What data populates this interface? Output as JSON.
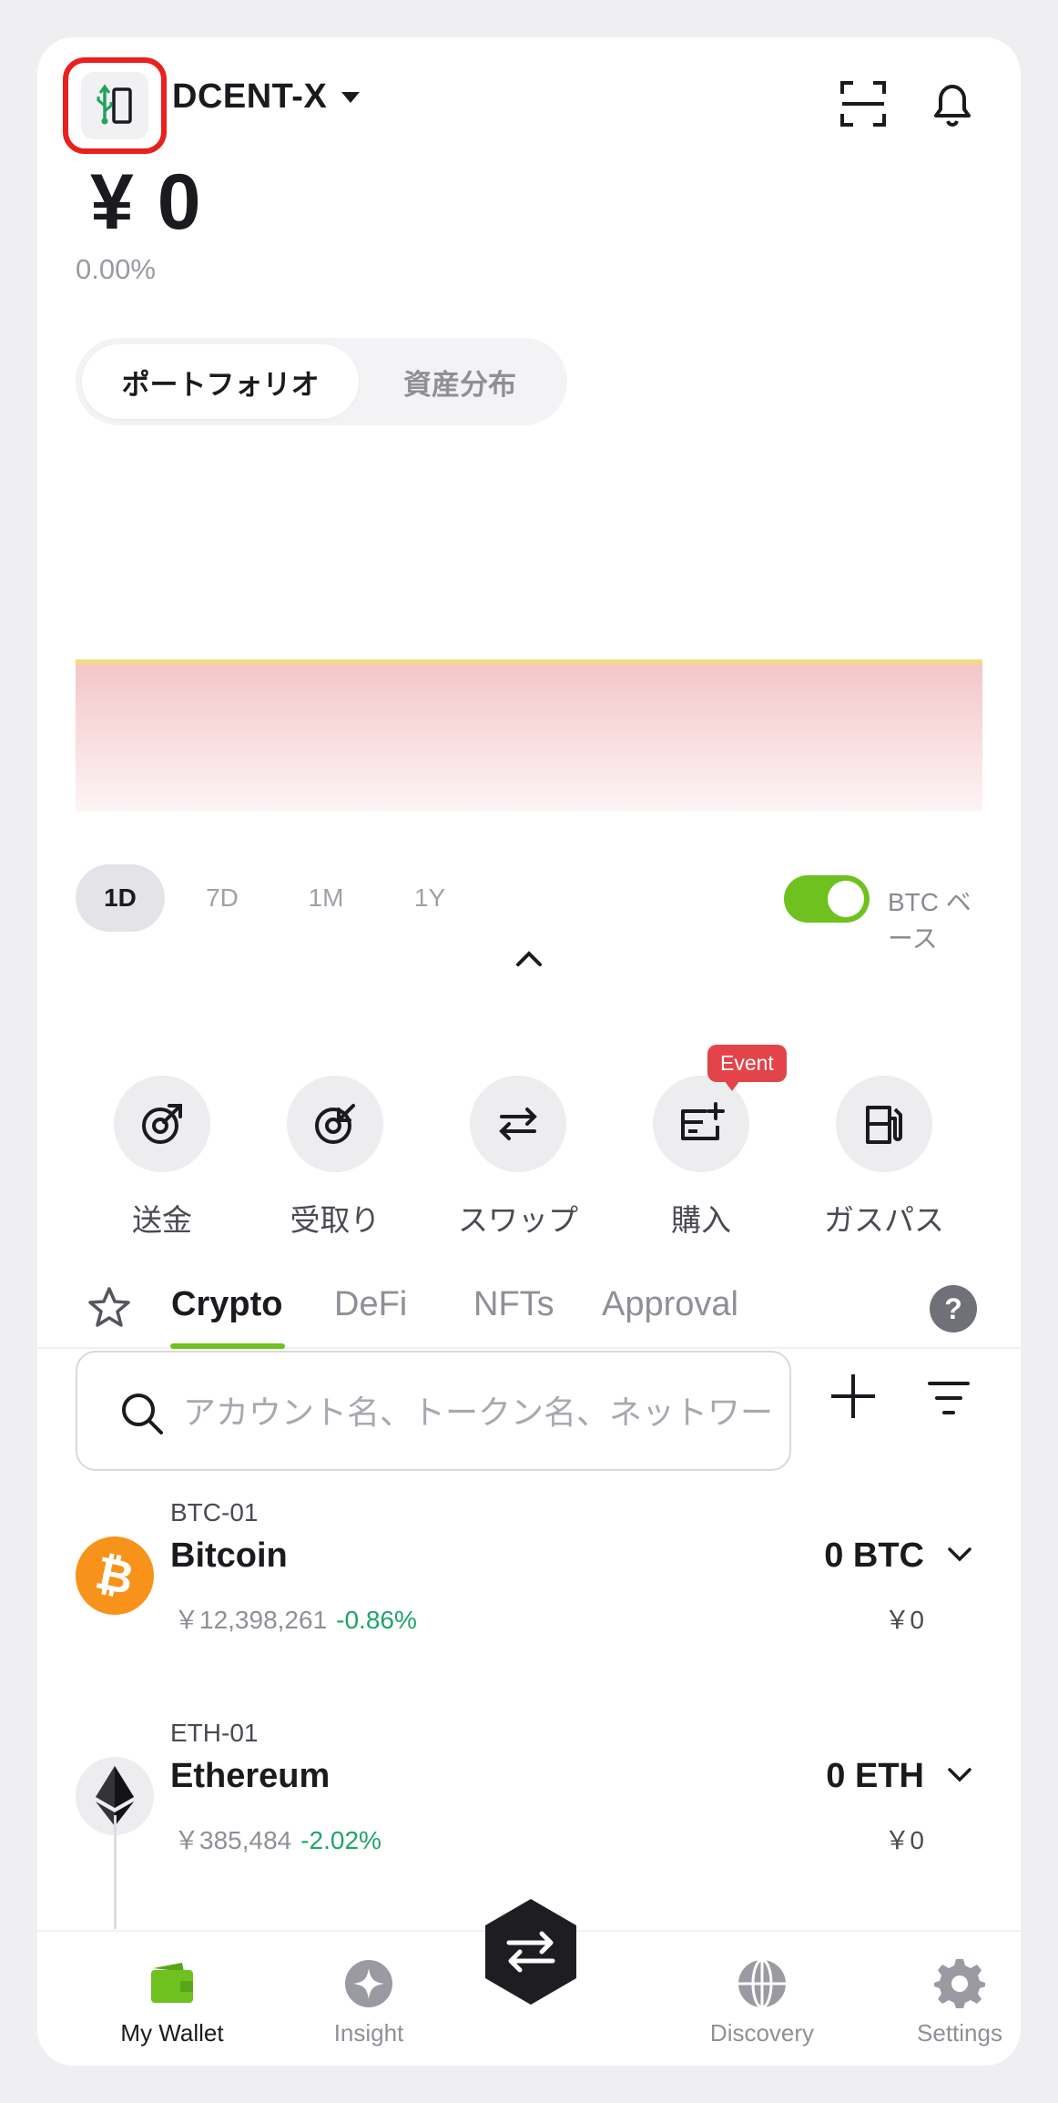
{
  "header": {
    "wallet_name": "DCENT-X",
    "balance": "¥ 0",
    "change_pct": "0.00%"
  },
  "segments": {
    "portfolio": "ポートフォリオ",
    "distribution": "資産分布"
  },
  "periods": [
    "1D",
    "7D",
    "1M",
    "1Y"
  ],
  "btc_toggle": {
    "label": "BTC ベース",
    "on": true
  },
  "actions": {
    "send": "送金",
    "receive": "受取り",
    "swap": "スワップ",
    "buy": "購入",
    "gas": "ガスパス",
    "event_badge": "Event"
  },
  "tabs": {
    "crypto": "Crypto",
    "defi": "DeFi",
    "nfts": "NFTs",
    "approval": "Approval",
    "help": "?"
  },
  "search": {
    "placeholder": "アカウント名、トークン名、ネットワーク名"
  },
  "assets": [
    {
      "account": "BTC-01",
      "name": "Bitcoin",
      "price": "￥12,398,261",
      "change": "-0.86%",
      "amount": "0 BTC",
      "fiat": "￥0"
    },
    {
      "account": "ETH-01",
      "name": "Ethereum",
      "price": "￥385,484",
      "change": "-2.02%",
      "amount": "0 ETH",
      "fiat": "￥0"
    }
  ],
  "nav": {
    "wallet": "My Wallet",
    "insight": "Insight",
    "discovery": "Discovery",
    "settings": "Settings"
  },
  "colors": {
    "accent": "#6ec11f",
    "negative_change": "#1fa46b",
    "highlight_border": "#e8201f",
    "event": "#e2444a"
  }
}
